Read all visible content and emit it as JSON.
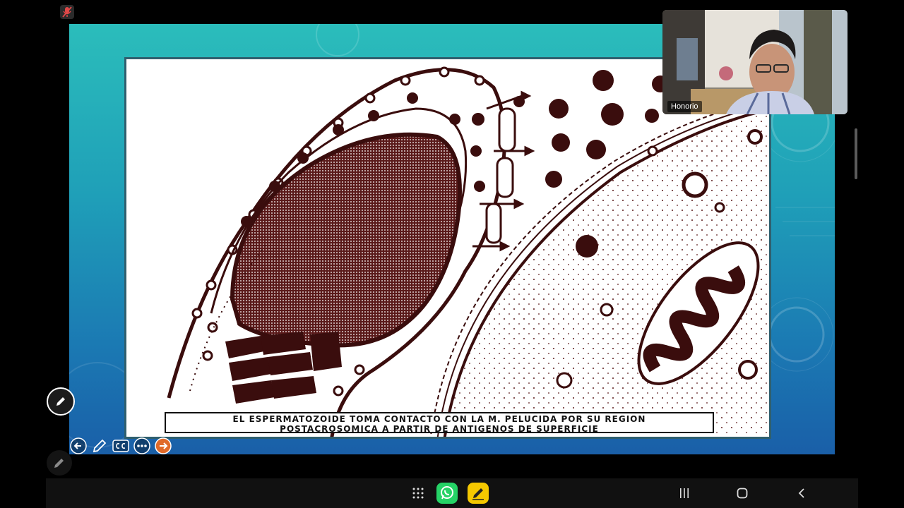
{
  "slide": {
    "caption_line1": "EL ESPERMATOZOIDE TOMA CONTACTO CON LA M. PELUCIDA POR SU REGION",
    "caption_line2": "POSTACROSOMICA  A PARTIR DE ANTIGENOS    DE SUPERFICIE"
  },
  "participant": {
    "name": "Honorio"
  },
  "icons": {
    "mic": "mic-muted-icon",
    "annotate": "pencil-icon",
    "prev": "arrow-left-circle-icon",
    "pen": "pen-icon",
    "cc": "closed-captions-icon",
    "more": "more-dots-icon",
    "next": "arrow-right-circle-icon",
    "apps": "apps-grid-icon",
    "whatsapp": "whatsapp-icon",
    "notes": "notes-pen-icon",
    "recents": "recents-icon",
    "home": "home-icon",
    "back": "back-chevron-icon"
  },
  "colors": {
    "slide_top": "#2bbdbb",
    "slide_bottom": "#1a5fa8",
    "next_accent": "#e06a2a",
    "whatsapp": "#25d366",
    "notes_app": "#f5c800"
  }
}
